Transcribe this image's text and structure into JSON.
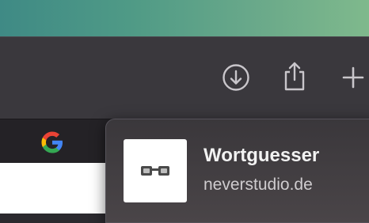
{
  "popover": {
    "app_name": "Wortguesser",
    "domain": "neverstudio.de"
  },
  "toolbar": {
    "icons": [
      "download-icon",
      "share-icon",
      "new-tab-plus-icon"
    ]
  },
  "tab": {
    "favicon": "google-favicon"
  }
}
